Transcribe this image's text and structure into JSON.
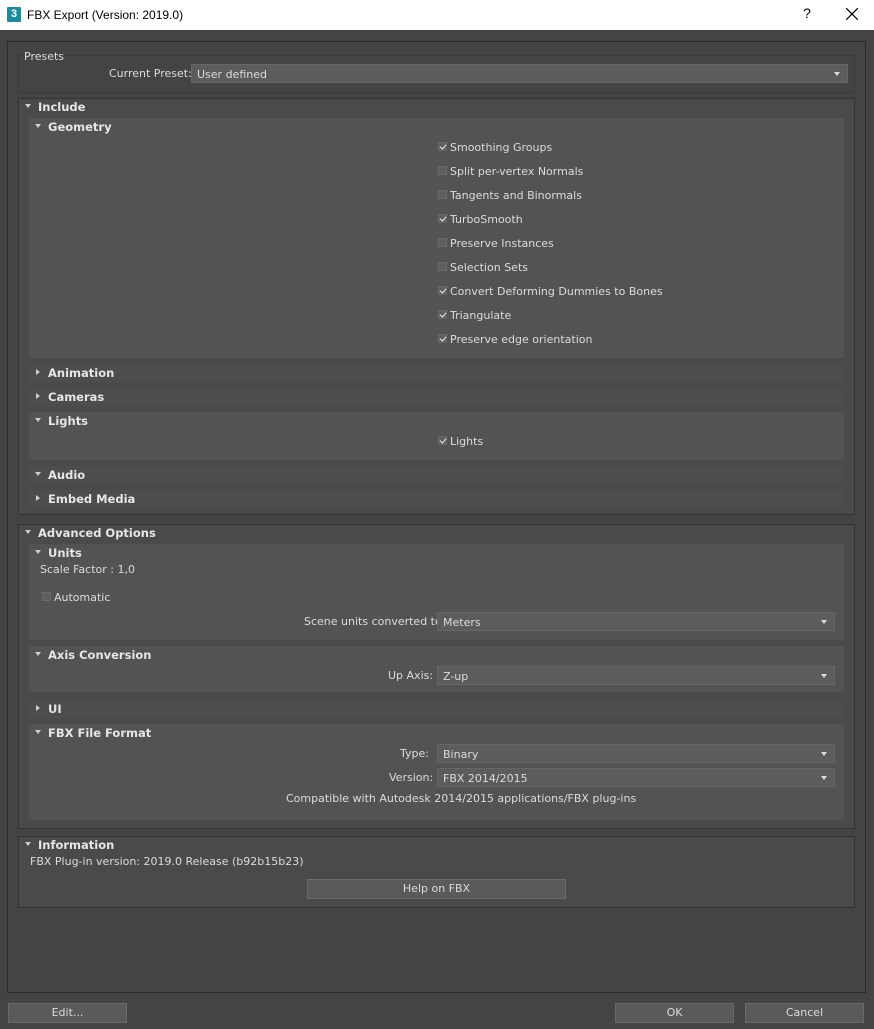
{
  "window": {
    "title": "FBX Export (Version: 2019.0)",
    "icon_text": "3",
    "help": "?"
  },
  "presets": {
    "group_label": "Presets",
    "current_preset_label": "Current Preset:",
    "current_preset_value": "User defined"
  },
  "include": {
    "label": "Include",
    "geometry": {
      "label": "Geometry",
      "options": [
        {
          "label": "Smoothing Groups",
          "checked": true
        },
        {
          "label": "Split per-vertex Normals",
          "checked": false
        },
        {
          "label": "Tangents and Binormals",
          "checked": false
        },
        {
          "label": "TurboSmooth",
          "checked": true
        },
        {
          "label": "Preserve Instances",
          "checked": false
        },
        {
          "label": "Selection Sets",
          "checked": false
        },
        {
          "label": "Convert Deforming Dummies to Bones",
          "checked": true
        },
        {
          "label": "Triangulate",
          "checked": true
        },
        {
          "label": "Preserve edge orientation",
          "checked": true
        }
      ]
    },
    "animation_label": "Animation",
    "cameras_label": "Cameras",
    "lights": {
      "label": "Lights",
      "option_label": "Lights",
      "checked": true
    },
    "audio_label": "Audio",
    "embed_media_label": "Embed Media"
  },
  "advanced": {
    "label": "Advanced Options",
    "units": {
      "label": "Units",
      "scale_factor": "Scale Factor : 1,0",
      "automatic_label": "Automatic",
      "automatic_checked": false,
      "scene_units_label": "Scene units converted to:",
      "scene_units_value": "Meters"
    },
    "axis": {
      "label": "Axis Conversion",
      "up_axis_label": "Up Axis:",
      "up_axis_value": "Z-up"
    },
    "ui_label": "UI",
    "file_format": {
      "label": "FBX File Format",
      "type_label": "Type:",
      "type_value": "Binary",
      "version_label": "Version:",
      "version_value": "FBX 2014/2015",
      "compat_note": "Compatible with Autodesk 2014/2015 applications/FBX plug-ins"
    }
  },
  "information": {
    "label": "Information",
    "plugin_version": "FBX Plug-in version: 2019.0 Release (b92b15b23)",
    "help_button": "Help on FBX"
  },
  "footer": {
    "edit_button": "Edit...",
    "ok_button": "OK",
    "cancel_button": "Cancel"
  }
}
